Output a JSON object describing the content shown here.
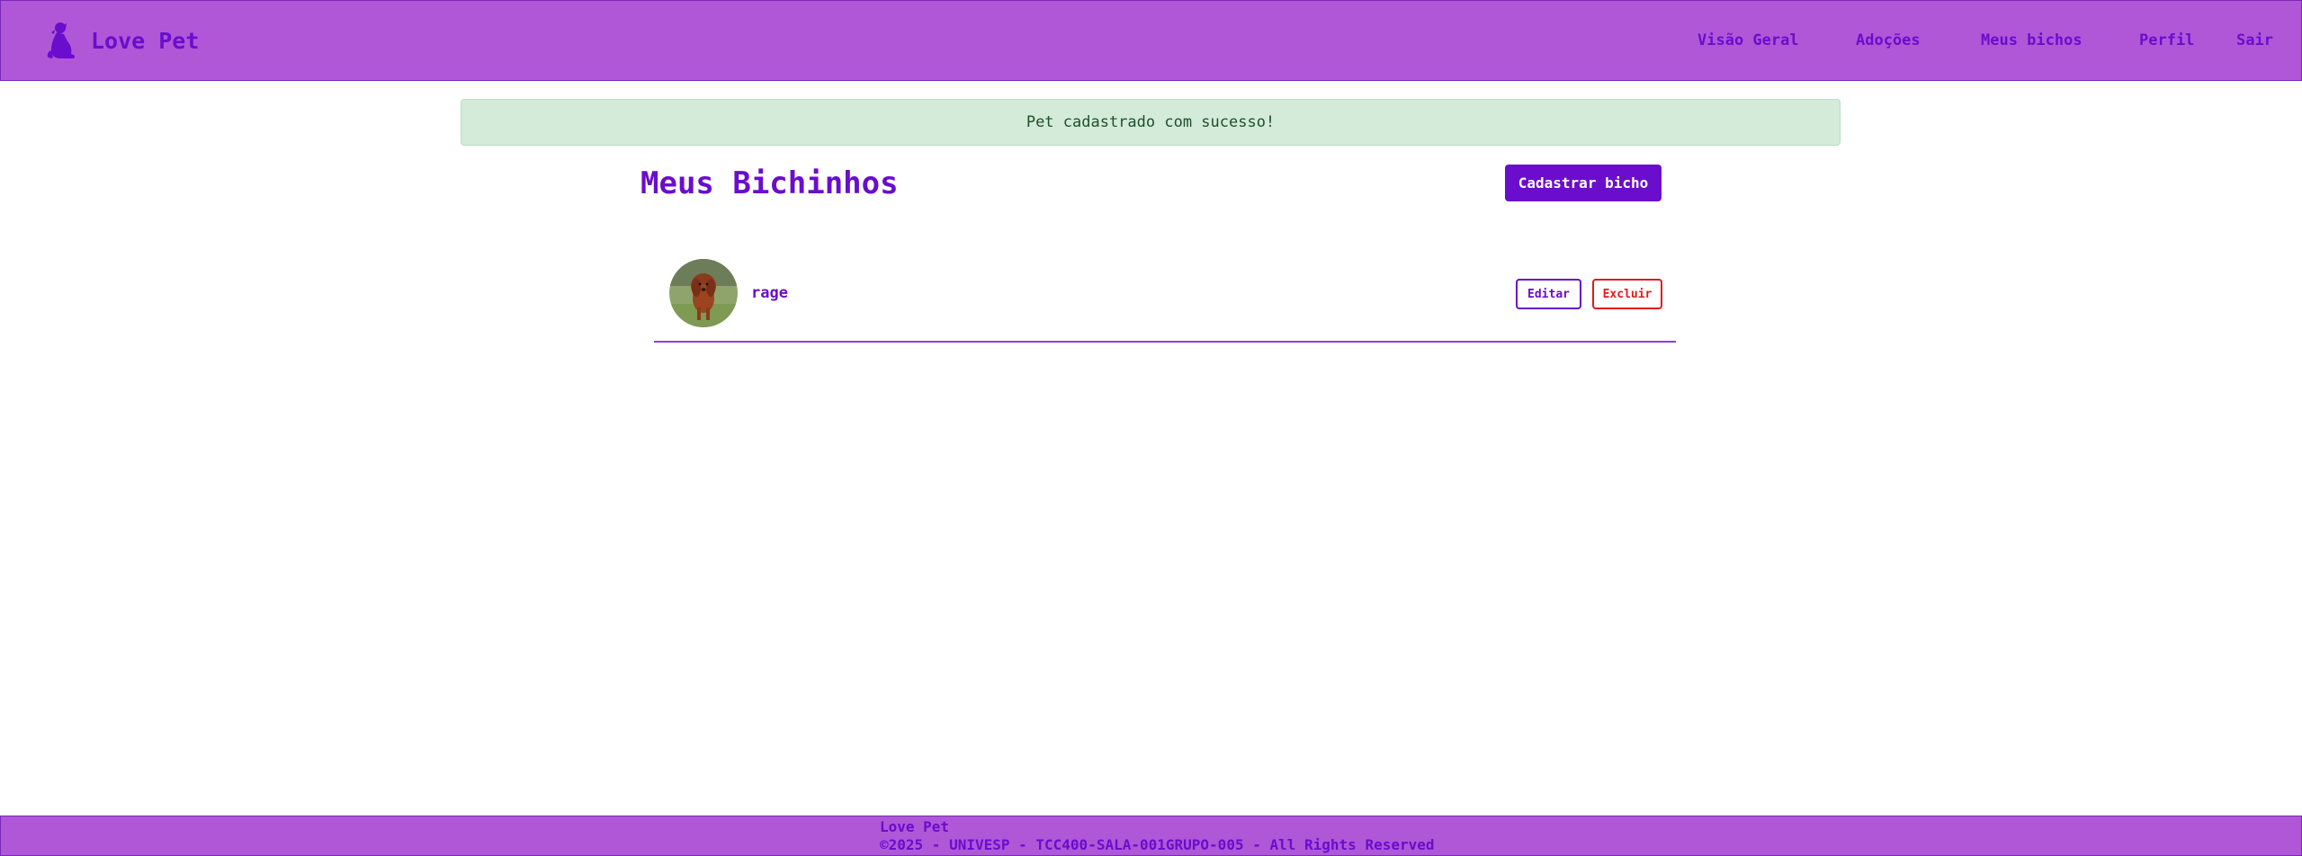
{
  "header": {
    "brand": "Love Pet",
    "nav": {
      "overview": "Visão Geral",
      "adoptions": "Adoções",
      "my_pets": "Meus bichos",
      "profile": "Perfil",
      "logout": "Sair"
    }
  },
  "alert": {
    "message": "Pet cadastrado com sucesso!"
  },
  "main": {
    "title": "Meus Bichinhos",
    "register_button": "Cadastrar bicho",
    "pets": [
      {
        "name": "rage",
        "edit_label": "Editar",
        "delete_label": "Excluir"
      }
    ]
  },
  "footer": {
    "title": "Love Pet",
    "copyright": "©2025 - UNIVESP - TCC400-SALA-001GRUPO-005 - All Rights Reserved"
  },
  "colors": {
    "header_bg": "#b057d8",
    "accent": "#6a0dcc",
    "success_bg": "#d4ebd9",
    "danger": "#e01b1b"
  },
  "icons": {
    "brand": "dog-icon"
  }
}
